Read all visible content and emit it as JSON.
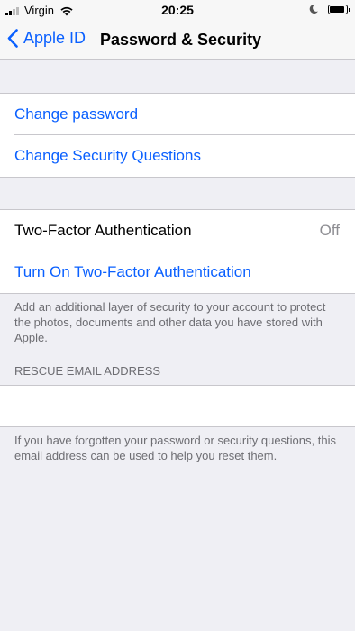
{
  "status_bar": {
    "carrier": "Virgin",
    "time": "20:25"
  },
  "nav": {
    "back_label": "Apple ID",
    "title": "Password & Security"
  },
  "group1": {
    "change_password": "Change password",
    "change_security_questions": "Change Security Questions"
  },
  "group2": {
    "two_factor_label": "Two-Factor Authentication",
    "two_factor_value": "Off",
    "turn_on_label": "Turn On Two-Factor Authentication",
    "footer": "Add an additional layer of security to your account to protect the photos, documents and other data you have stored with Apple."
  },
  "rescue_email": {
    "header": "RESCUE EMAIL ADDRESS",
    "value": "",
    "footer": "If you have forgotten your password or security questions, this email address can be used to help you reset them."
  },
  "colors": {
    "accent": "#0a60ff",
    "background": "#efeff4",
    "secondary_text": "#6d6d72"
  },
  "icons": {
    "signal": "signal-icon",
    "wifi": "wifi-icon",
    "moon": "moon-icon",
    "battery": "battery-icon",
    "back": "chevron-left-icon"
  }
}
